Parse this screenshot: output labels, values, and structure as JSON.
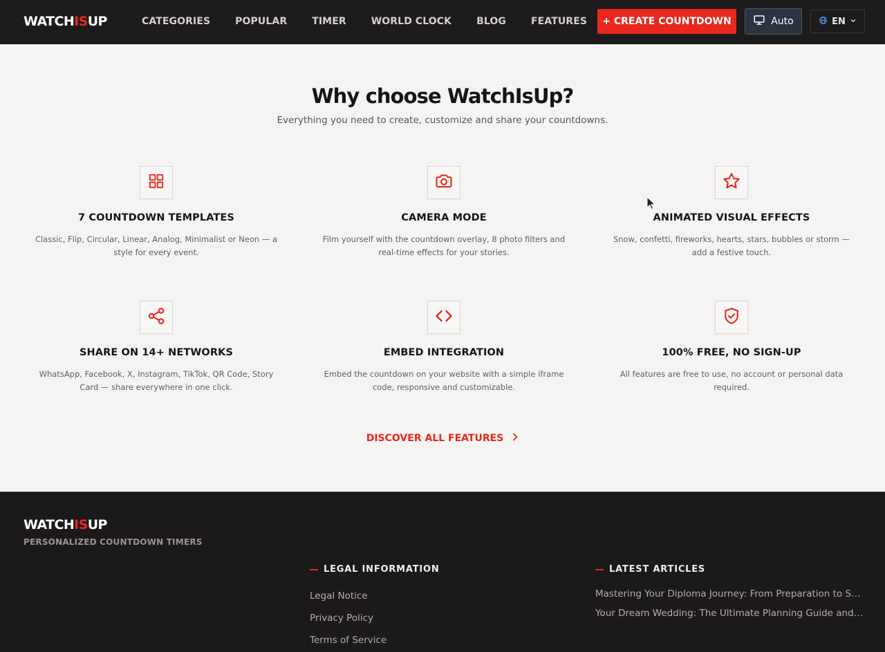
{
  "header": {
    "logo": {
      "part1": "WATCH",
      "part2": "IS",
      "part3": "UP"
    },
    "nav": [
      "CATEGORIES",
      "POPULAR",
      "TIMER",
      "WORLD CLOCK",
      "BLOG",
      "FEATURES"
    ],
    "cta_label": "+ CREATE COUNTDOWN",
    "theme_label": "Auto",
    "language_label": "EN"
  },
  "main": {
    "title": "Why choose WatchIsUp?",
    "subtitle": "Everything you need to create, customize and share your countdowns.",
    "features": [
      {
        "icon": "grid-icon",
        "title": "7 COUNTDOWN TEMPLATES",
        "desc": "Classic, Flip, Circular, Linear, Analog, Minimalist or Neon — a style for every event."
      },
      {
        "icon": "camera-icon",
        "title": "CAMERA MODE",
        "desc": "Film yourself with the countdown overlay, 8 photo filters and real-time effects for your stories."
      },
      {
        "icon": "star-icon",
        "title": "ANIMATED VISUAL EFFECTS",
        "desc": "Snow, confetti, fireworks, hearts, stars, bubbles or storm — add a festive touch."
      },
      {
        "icon": "share-icon",
        "title": "SHARE ON 14+ NETWORKS",
        "desc": "WhatsApp, Facebook, X, Instagram, TikTok, QR Code, Story Card — share everywhere in one click."
      },
      {
        "icon": "code-icon",
        "title": "EMBED INTEGRATION",
        "desc": "Embed the countdown on your website with a simple iframe code, responsive and customizable."
      },
      {
        "icon": "shield-check-icon",
        "title": "100% FREE, NO SIGN-UP",
        "desc": "All features are free to use, no account or personal data required."
      }
    ],
    "discover_label": "DISCOVER ALL FEATURES"
  },
  "footer": {
    "logo": {
      "part1": "WATCH",
      "part2": "IS",
      "part3": "UP"
    },
    "tagline": "PERSONALIZED COUNTDOWN TIMERS",
    "legal_heading": "LEGAL INFORMATION",
    "legal_links": [
      "Legal Notice",
      "Privacy Policy",
      "Terms of Service"
    ],
    "articles_heading": "LATEST ARTICLES",
    "articles": [
      "Mastering Your Diploma Journey: From Preparation to Success",
      "Your Dream Wedding: The Ultimate Planning Guide and Why …"
    ]
  },
  "colors": {
    "accent": "#e8281e",
    "header_bg": "#1d1b1b",
    "page_bg": "#f5f4f2",
    "footer_bg": "#1b1919"
  }
}
